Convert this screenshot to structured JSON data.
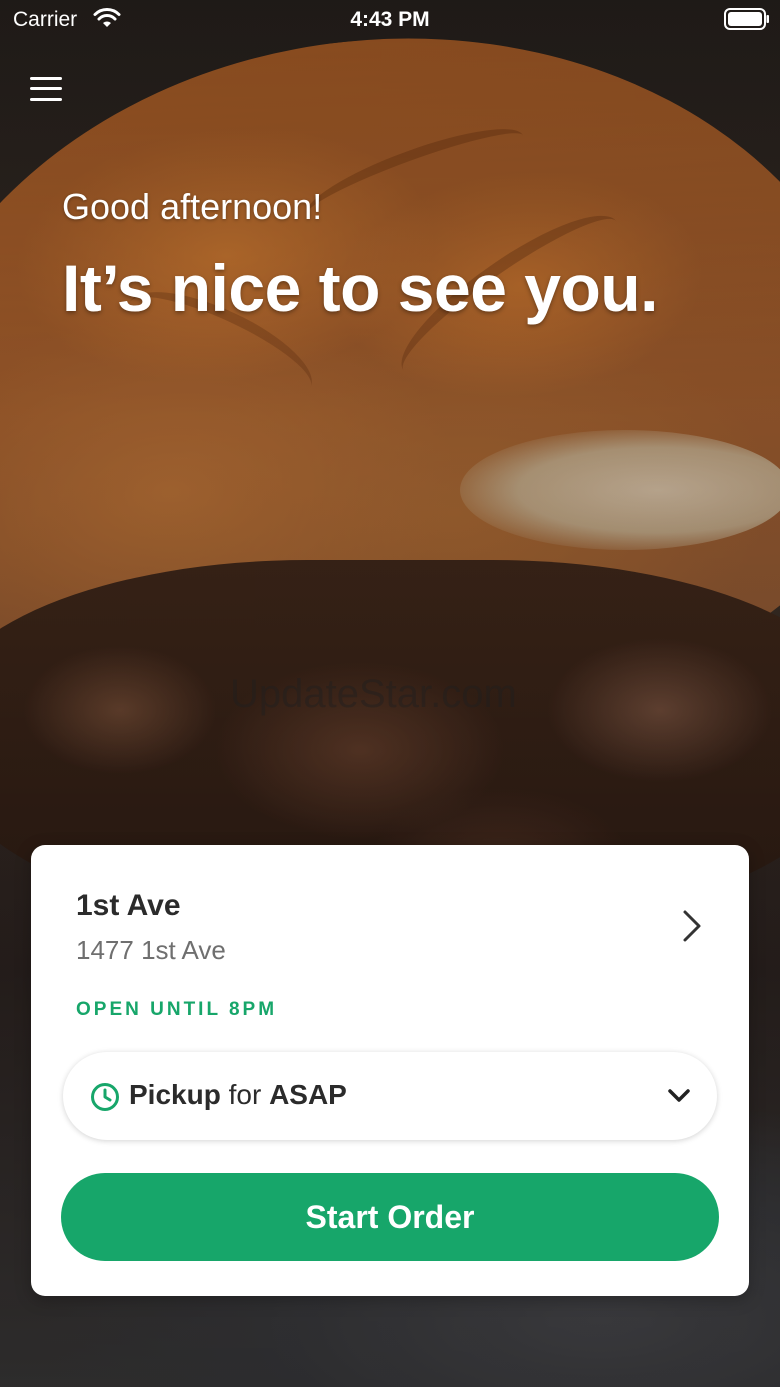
{
  "status_bar": {
    "carrier": "Carrier",
    "time": "4:43 PM",
    "wifi_icon": "wifi-icon",
    "battery_icon": "battery-icon"
  },
  "header": {
    "menu_icon": "hamburger-menu-icon"
  },
  "hero": {
    "greeting": "Good afternoon!",
    "headline": "It’s nice to see you.",
    "watermark": "UpdateStar.com"
  },
  "location_card": {
    "name": "1st Ave",
    "address": "1477 1st Ave",
    "status": "OPEN UNTIL 8PM",
    "chevron_icon": "chevron-right-icon"
  },
  "order_type": {
    "icon": "clock-icon",
    "mode": "Pickup",
    "connector": "for",
    "time": "ASAP",
    "dropdown_icon": "chevron-down-icon"
  },
  "actions": {
    "start_order_label": "Start Order"
  },
  "colors": {
    "accent": "#17a66a",
    "text_primary": "#2b2b2b",
    "text_secondary": "#6f6f6f",
    "card_background": "#ffffff"
  }
}
